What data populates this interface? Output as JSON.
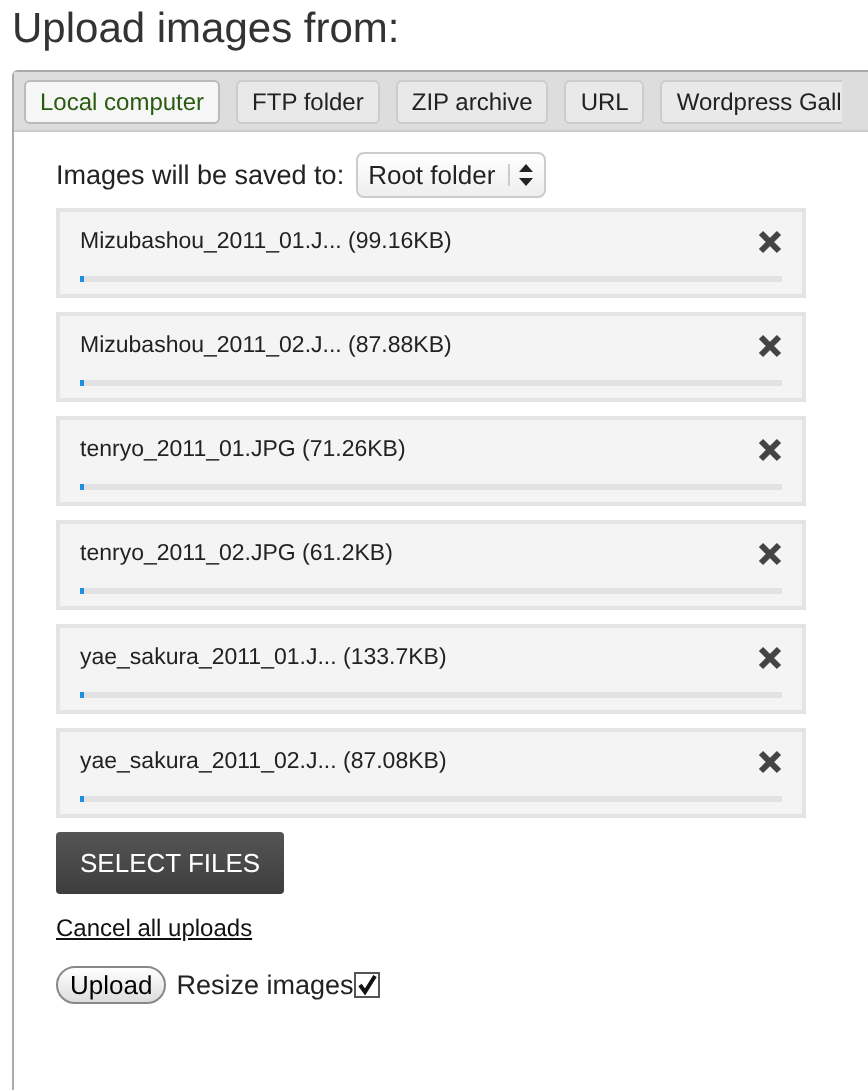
{
  "title": "Upload images from:",
  "tabs": [
    {
      "label": "Local computer",
      "selected": true
    },
    {
      "label": "FTP folder",
      "selected": false
    },
    {
      "label": "ZIP archive",
      "selected": false
    },
    {
      "label": "URL",
      "selected": false
    },
    {
      "label": "Wordpress Gall",
      "selected": false
    }
  ],
  "save_to": {
    "label": "Images will be saved to:",
    "value": "Root folder"
  },
  "files": [
    {
      "name": "Mizubashou_2011_01.J... (99.16KB)",
      "level": 0.005
    },
    {
      "name": "Mizubashou_2011_02.J... (87.88KB)",
      "level": 0.005
    },
    {
      "name": "tenryo_2011_01.JPG (71.26KB)",
      "level": 0.005
    },
    {
      "name": "tenryo_2011_02.JPG (61.2KB)",
      "level": 0.005
    },
    {
      "name": "yae_sakura_2011_01.J... (133.7KB)",
      "level": 0.005
    },
    {
      "name": "yae_sakura_2011_02.J... (87.08KB)",
      "level": 0.005
    }
  ],
  "select_button": "SELECT FILES",
  "cancel_link": "Cancel all uploads",
  "upload_button": "Upload",
  "resize": {
    "label": "Resize images",
    "checked": true
  }
}
